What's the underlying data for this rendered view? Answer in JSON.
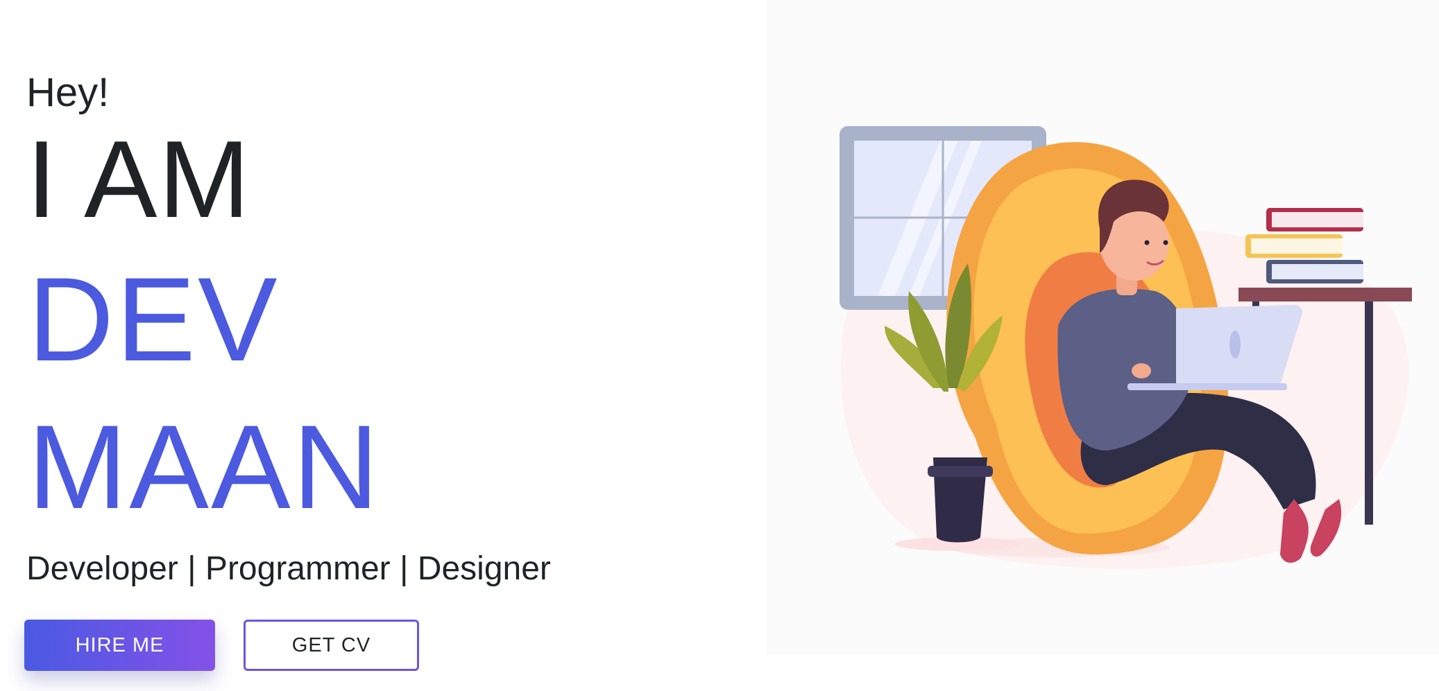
{
  "hero": {
    "greeting": "Hey!",
    "intro": "I AM",
    "first_name": "DEV",
    "last_name": "MAAN",
    "roles": "Developer | Programmer | Designer"
  },
  "actions": {
    "hire_label": "HIRE ME",
    "cv_label": "GET CV"
  },
  "colors": {
    "accent": "#4c5ae0",
    "button_gradient_start": "#4a5ae2",
    "button_gradient_end": "#8451e8",
    "text": "#1f2326"
  }
}
